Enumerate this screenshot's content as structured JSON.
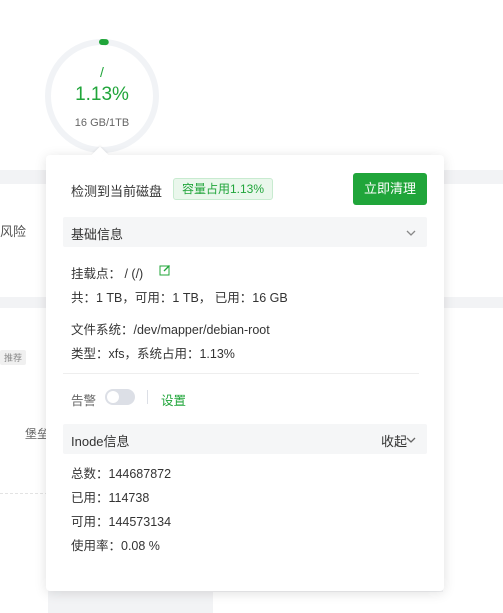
{
  "background": {
    "risk_text": "风险",
    "tag_text": "推荐",
    "fort_text": "堡垒"
  },
  "disk": {
    "mount": "/",
    "usage_percent": "1.13%",
    "usage_fraction": 0.0113,
    "size": "16 GB/1TB",
    "accent_color": "#20a53a"
  },
  "popover": {
    "title": "检测到当前磁盘",
    "capacity_badge": "容量占用1.13%",
    "clean_button": "立即清理",
    "basic_section": {
      "title": "基础信息",
      "mount_point": "挂载点： / (/)",
      "capacity": "共：1 TB，可用：1 TB， 已用：16 GB",
      "filesystem": "文件系统：/dev/mapper/debian-root",
      "type": "类型：xfs，系统占用：1.13%"
    },
    "alert": {
      "label": "告警",
      "enabled": false,
      "settings_link": "设置"
    },
    "inode_section": {
      "title": "Inode信息",
      "collapse_label": "收起",
      "total": "总数：144687872",
      "used": "已用：114738",
      "available": "可用：144573134",
      "usage_rate": "使用率：0.08 %"
    }
  }
}
